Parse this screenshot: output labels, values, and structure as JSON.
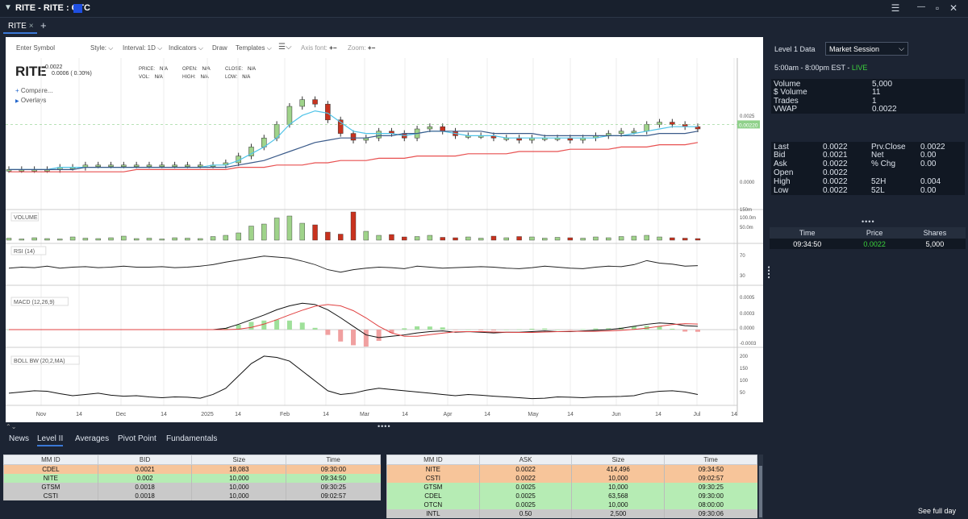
{
  "window": {
    "title": "RITE - RITE : OTC",
    "accent": "#1f4fe0"
  },
  "tabs": [
    {
      "label": "RITE",
      "close": "×"
    }
  ],
  "toolbar": {
    "symbol_placeholder": "Enter Symbol",
    "style": "Style:",
    "interval": "Interval: 1D",
    "indicators": "Indicators",
    "draw": "Draw",
    "templates": "Templates",
    "axis_font": "Axis font:",
    "zoom": "Zoom:"
  },
  "symbol": {
    "ticker": "RITE",
    "price": "0.0022",
    "change": "0.0006 ( 0.00%)"
  },
  "ohlc": {
    "price": "N/A",
    "vol": "N/A",
    "open": "N/A",
    "high": "N/A",
    "close": "N/A",
    "low": "N/A",
    "price_label": "PRICE:",
    "vol_label": "VOL:",
    "open_label": "OPEN:",
    "high_label": "HIGH:",
    "close_label": "CLOSE:",
    "low_label": "LOW:"
  },
  "chart_links": {
    "compare": "Compare...",
    "overlays": "Overlays"
  },
  "chart_data": {
    "type": "line",
    "title": "",
    "price_axis_ticks": [
      "0.0025",
      "0.0000"
    ],
    "last_price_label": "0.00220",
    "x_ticks": [
      "Nov",
      "14",
      "Dec",
      "14",
      "2025",
      "14",
      "Feb",
      "14",
      "Mar",
      "14",
      "Apr",
      "14",
      "May",
      "14",
      "Jun",
      "14",
      "Jul",
      "14"
    ],
    "panes": [
      {
        "label": "VOLUME",
        "ticks": [
          "150m",
          "100.0m",
          "50.0m"
        ]
      },
      {
        "label": "RSI (14)",
        "ticks": [
          "70",
          "30"
        ]
      },
      {
        "label": "MACD (12,26,9)",
        "ticks": [
          "0.0005",
          "0.0003",
          "0.0000",
          "-0.0003"
        ]
      },
      {
        "label": "BOLL BW (20,2,MA)",
        "ticks": [
          "200",
          "150",
          "100",
          "50"
        ]
      }
    ],
    "price": [
      0.0002,
      0.0002,
      0.0002,
      0.0002,
      0.0003,
      0.0003,
      0.0004,
      0.0004,
      0.0004,
      0.0004,
      0.0004,
      0.0004,
      0.0004,
      0.0004,
      0.0004,
      0.0004,
      0.0004,
      0.0005,
      0.0008,
      0.0012,
      0.0016,
      0.0022,
      0.003,
      0.0033,
      0.0031,
      0.0024,
      0.0018,
      0.0015,
      0.0016,
      0.0019,
      0.0018,
      0.0016,
      0.002,
      0.0021,
      0.0019,
      0.0017,
      0.0017,
      0.0017,
      0.0016,
      0.0016,
      0.0015,
      0.0016,
      0.0016,
      0.0016,
      0.0015,
      0.0016,
      0.0017,
      0.0018,
      0.0019,
      0.0019,
      0.0022,
      0.0023,
      0.0022,
      0.0021,
      0.002
    ],
    "ema_fast": [
      0.0002,
      0.0002,
      0.0002,
      0.0002,
      0.0003,
      0.0003,
      0.0003,
      0.0003,
      0.0003,
      0.0003,
      0.0003,
      0.0003,
      0.0003,
      0.0003,
      0.0003,
      0.0003,
      0.0004,
      0.0004,
      0.0006,
      0.0009,
      0.0012,
      0.0016,
      0.0022,
      0.0026,
      0.0028,
      0.0027,
      0.0023,
      0.0019,
      0.0018,
      0.0018,
      0.0018,
      0.0017,
      0.0018,
      0.0019,
      0.0019,
      0.0018,
      0.0017,
      0.0017,
      0.0017,
      0.0016,
      0.0016,
      0.0016,
      0.0016,
      0.0016,
      0.0016,
      0.0016,
      0.0016,
      0.0017,
      0.0017,
      0.0018,
      0.0019,
      0.002,
      0.0021,
      0.0021,
      0.0021
    ],
    "ema_slow": [
      0.0002,
      0.0002,
      0.0002,
      0.0002,
      0.0002,
      0.0002,
      0.0003,
      0.0003,
      0.0003,
      0.0003,
      0.0003,
      0.0003,
      0.0003,
      0.0003,
      0.0003,
      0.0003,
      0.0003,
      0.0003,
      0.0004,
      0.0005,
      0.0006,
      0.0008,
      0.001,
      0.0012,
      0.0014,
      0.0015,
      0.0016,
      0.0016,
      0.0016,
      0.0017,
      0.0017,
      0.0018,
      0.0018,
      0.0019,
      0.0019,
      0.0019,
      0.0019,
      0.0019,
      0.0018,
      0.0018,
      0.0018,
      0.0018,
      0.0017,
      0.0017,
      0.0017,
      0.0017,
      0.0017,
      0.0017,
      0.0017,
      0.0017,
      0.0017,
      0.0018,
      0.0018,
      0.0018,
      0.0019
    ],
    "sma": [
      0.0001,
      0.0001,
      0.0001,
      0.0001,
      0.0001,
      0.0001,
      0.0001,
      0.0001,
      0.0001,
      0.0001,
      0.0002,
      0.0002,
      0.0002,
      0.0002,
      0.0002,
      0.0002,
      0.0002,
      0.0002,
      0.0003,
      0.0003,
      0.0003,
      0.0004,
      0.0004,
      0.0004,
      0.0005,
      0.0005,
      0.0006,
      0.0006,
      0.0006,
      0.0007,
      0.0007,
      0.0007,
      0.0008,
      0.0008,
      0.0008,
      0.0008,
      0.0009,
      0.0009,
      0.0009,
      0.0009,
      0.001,
      0.001,
      0.001,
      0.001,
      0.0011,
      0.0011,
      0.0011,
      0.0011,
      0.0012,
      0.0012,
      0.0012,
      0.0013,
      0.0013,
      0.0013,
      0.0014
    ],
    "volume": [
      5,
      3,
      6,
      4,
      3,
      8,
      5,
      4,
      6,
      10,
      4,
      5,
      3,
      6,
      5,
      4,
      9,
      12,
      18,
      35,
      40,
      55,
      60,
      42,
      38,
      20,
      15,
      70,
      22,
      12,
      14,
      8,
      9,
      12,
      7,
      6,
      8,
      5,
      10,
      6,
      9,
      8,
      5,
      7,
      6,
      5,
      8,
      6,
      9,
      10,
      12,
      8,
      6,
      5,
      4
    ],
    "rsi": [
      48,
      50,
      49,
      52,
      48,
      50,
      51,
      49,
      50,
      52,
      50,
      50,
      51,
      49,
      50,
      52,
      55,
      60,
      64,
      68,
      72,
      70,
      68,
      62,
      55,
      45,
      40,
      45,
      48,
      50,
      49,
      47,
      52,
      50,
      48,
      49,
      50,
      51,
      50,
      48,
      47,
      49,
      52,
      50,
      48,
      47,
      50,
      52,
      51,
      55,
      63,
      58,
      56,
      52,
      53
    ],
    "macd": [
      0,
      0,
      0,
      0,
      0,
      0,
      0,
      0,
      0,
      0,
      0,
      0,
      0,
      0,
      0,
      0,
      0,
      2e-05,
      8e-05,
      0.00015,
      0.00022,
      0.0003,
      0.00036,
      0.0004,
      0.00038,
      0.0003,
      0.00018,
      5e-05,
      -8e-05,
      -0.00012,
      -0.0001,
      -8e-05,
      -5e-05,
      -3e-05,
      -2e-05,
      -4e-05,
      -3e-05,
      -4e-05,
      -5e-05,
      -4e-05,
      -4e-05,
      -3e-05,
      -2e-05,
      -3e-05,
      -3e-05,
      -2e-05,
      -1e-05,
      0,
      2e-05,
      5e-05,
      8e-05,
      0.0001,
      9e-05,
      6e-05,
      5e-05
    ],
    "boll_bw": [
      60,
      65,
      70,
      68,
      58,
      50,
      55,
      60,
      52,
      48,
      50,
      45,
      42,
      45,
      44,
      40,
      55,
      80,
      130,
      180,
      210,
      205,
      190,
      150,
      110,
      70,
      55,
      60,
      72,
      80,
      75,
      70,
      65,
      60,
      55,
      50,
      55,
      52,
      48,
      45,
      42,
      38,
      40,
      45,
      44,
      42,
      45,
      46,
      47,
      50,
      62,
      68,
      70,
      65,
      55
    ]
  },
  "bottom_tabs": [
    "News",
    "Level II",
    "Averages",
    "Pivot Point",
    "Fundamentals"
  ],
  "level2": {
    "bid_headers": [
      "MM ID",
      "BID",
      "Size",
      "Time"
    ],
    "bids": [
      {
        "mm": "CDEL",
        "price": "0.0021",
        "size": "18,083",
        "time": "09:30:00",
        "color": "#f7c59a"
      },
      {
        "mm": "NITE",
        "price": "0.002",
        "size": "10,000",
        "time": "09:34:50",
        "color": "#b6ecb4"
      },
      {
        "mm": "GTSM",
        "price": "0.0018",
        "size": "10,000",
        "time": "09:30:25",
        "color": "#c9c9c9"
      },
      {
        "mm": "CSTI",
        "price": "0.0018",
        "size": "10,000",
        "time": "09:02:57",
        "color": "#c9c9c9"
      }
    ],
    "ask_headers": [
      "MM ID",
      "ASK",
      "Size",
      "Time"
    ],
    "asks": [
      {
        "mm": "NITE",
        "price": "0.0022",
        "size": "414,496",
        "time": "09:34:50",
        "color": "#f7c59a"
      },
      {
        "mm": "CSTI",
        "price": "0.0022",
        "size": "10,000",
        "time": "09:02:57",
        "color": "#f7c59a"
      },
      {
        "mm": "GTSM",
        "price": "0.0025",
        "size": "10,000",
        "time": "09:30:25",
        "color": "#b6ecb4"
      },
      {
        "mm": "CDEL",
        "price": "0.0025",
        "size": "63,568",
        "time": "09:30:00",
        "color": "#b6ecb4"
      },
      {
        "mm": "OTCN",
        "price": "0.0025",
        "size": "10,000",
        "time": "08:00:00",
        "color": "#b6ecb4"
      },
      {
        "mm": "INTL",
        "price": "0.50",
        "size": "2,500",
        "time": "09:30:06",
        "color": "#c9c9c9"
      }
    ]
  },
  "level1": {
    "title": "Level 1 Data",
    "session_select": "Market Session",
    "hours": "5:00am - 8:00pm EST - ",
    "live": "LIVE",
    "volume_block": [
      [
        "Volume",
        "5,000"
      ],
      [
        "$ Volume",
        "11"
      ],
      [
        " Trades",
        "1"
      ],
      [
        " VWAP",
        "0.0022"
      ]
    ],
    "quote_block": [
      [
        "Last",
        "0.0022",
        "Prv.Close",
        "0.0022"
      ],
      [
        "Bid",
        "0.0021",
        "Net",
        "0.00"
      ],
      [
        "Ask",
        "0.0022",
        "% Chg",
        "0.00"
      ],
      [
        "Open",
        "0.0022",
        "",
        ""
      ],
      [
        "High",
        "0.0022",
        "52H",
        "0.004"
      ],
      [
        "Low",
        "0.0022",
        "52L",
        "0.00"
      ]
    ]
  },
  "time_sales": {
    "headers": [
      "Time",
      "Price",
      "Shares"
    ],
    "rows": [
      {
        "time": "09:34:50",
        "price": "0.0022",
        "shares": "5,000"
      }
    ],
    "see_full_day": "See full day"
  }
}
